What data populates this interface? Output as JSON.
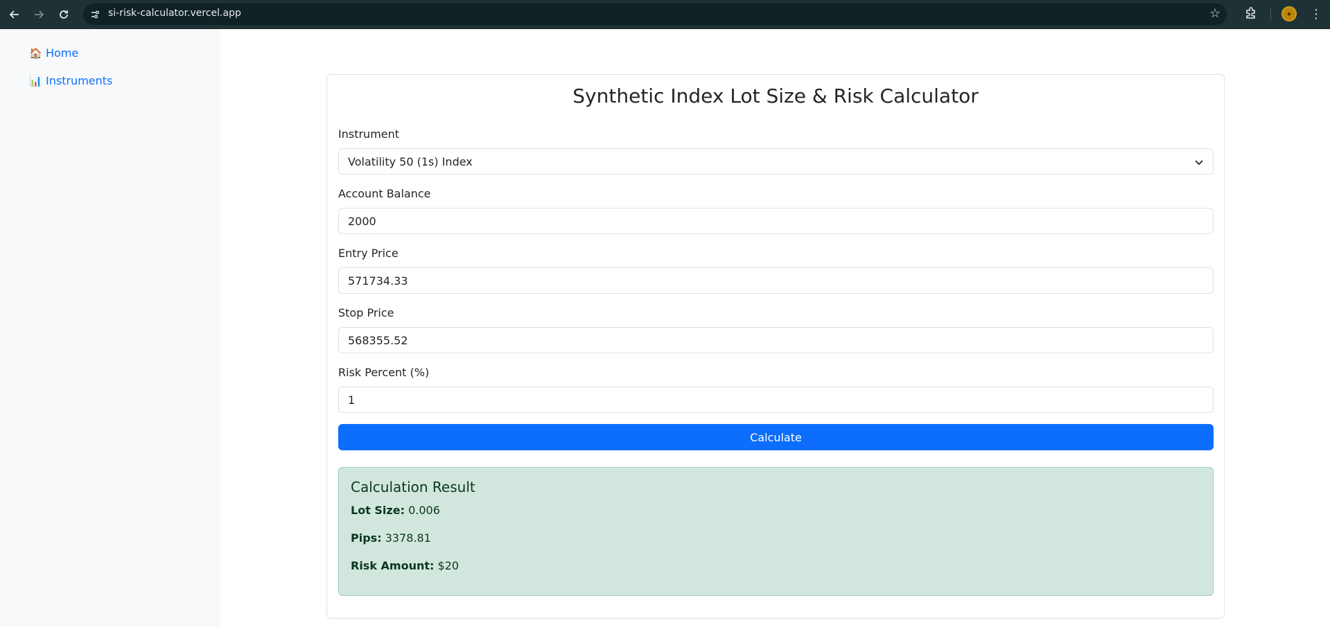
{
  "browser": {
    "url": "si-risk-calculator.vercel.app"
  },
  "sidebar": {
    "items": [
      {
        "icon": "🏠",
        "label": "Home"
      },
      {
        "icon": "📊",
        "label": "Instruments"
      }
    ]
  },
  "calculator": {
    "title": "Synthetic Index Lot Size & Risk Calculator",
    "instrument": {
      "label": "Instrument",
      "value": "Volatility 50 (1s) Index"
    },
    "account_balance": {
      "label": "Account Balance",
      "value": "2000"
    },
    "entry_price": {
      "label": "Entry Price",
      "value": "571734.33"
    },
    "stop_price": {
      "label": "Stop Price",
      "value": "568355.52"
    },
    "risk_percent": {
      "label": "Risk Percent (%)",
      "value": "1"
    },
    "calculate_label": "Calculate"
  },
  "result": {
    "title": "Calculation Result",
    "lot_size": {
      "label": "Lot Size:",
      "value": "0.006"
    },
    "pips": {
      "label": "Pips:",
      "value": "3378.81"
    },
    "risk_amount": {
      "label": "Risk Amount:",
      "value": "$20"
    }
  },
  "colors": {
    "primary": "#0d6efd",
    "success_bg": "#d1e7dd",
    "sidebar_bg": "#f8f9fa"
  }
}
